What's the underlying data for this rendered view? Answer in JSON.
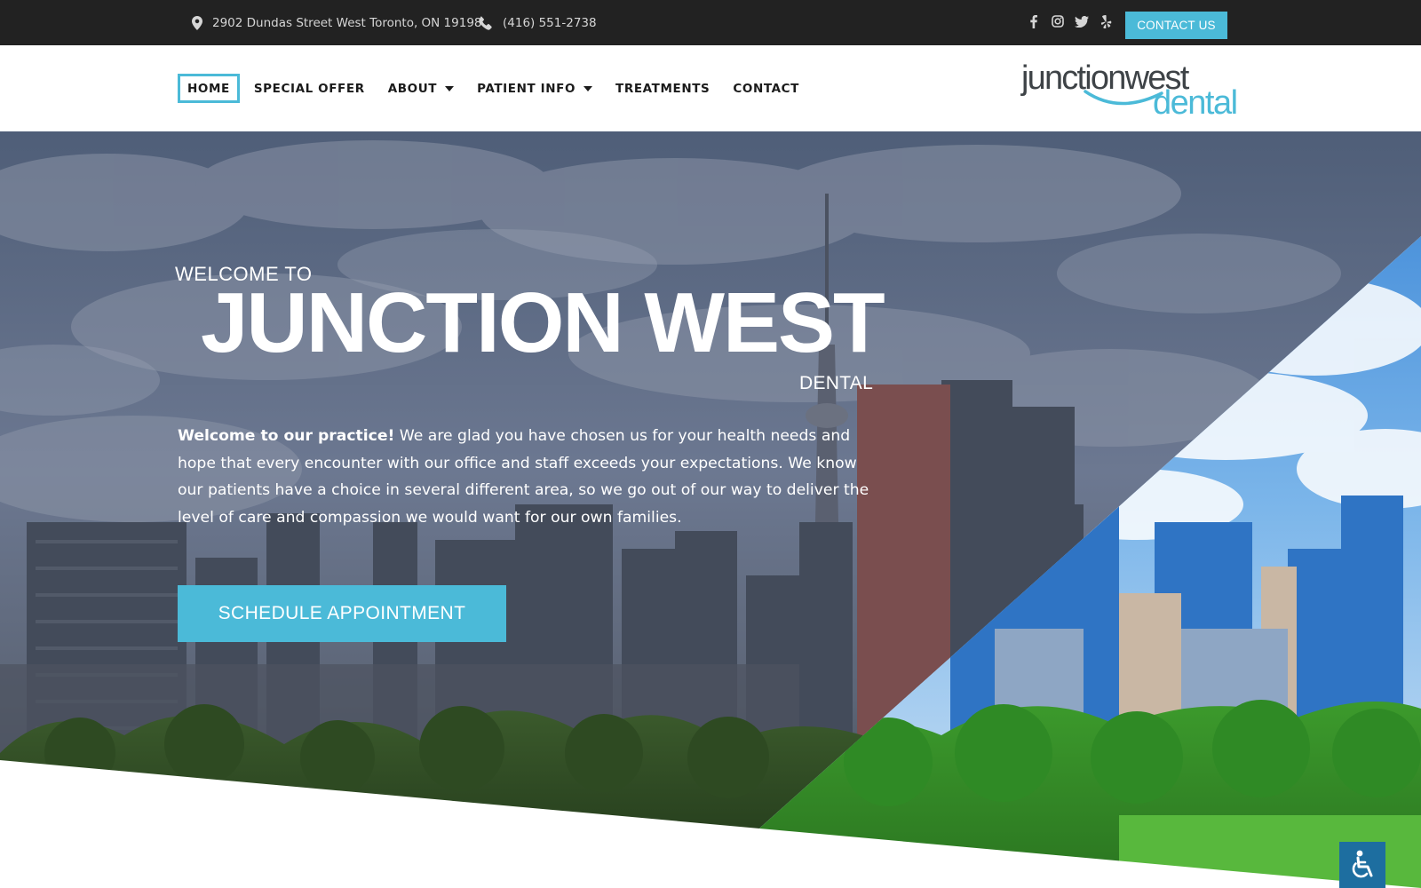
{
  "topbar": {
    "address": "2902 Dundas Street West Toronto, ON 19198",
    "phone": "(416) 551-2738",
    "socials": [
      "facebook-icon",
      "instagram-icon",
      "twitter-icon",
      "yelp-icon"
    ],
    "contact_label": "CONTACT US"
  },
  "nav": {
    "items": [
      {
        "label": "HOME",
        "active": true
      },
      {
        "label": "SPECIAL OFFER"
      },
      {
        "label": "ABOUT",
        "dropdown": true
      },
      {
        "label": "PATIENT INFO",
        "dropdown": true
      },
      {
        "label": "TREATMENTS"
      },
      {
        "label": "CONTACT"
      }
    ]
  },
  "logo": {
    "line1": "junctionwest",
    "line2": "dental"
  },
  "hero": {
    "welcome": "WELCOME TO",
    "title": "JUNCTION WEST",
    "subtitle": "DENTAL",
    "body_strong": "Welcome to our practice!",
    "body_text": " We are glad you have chosen us for your health needs and hope that every encounter with our office and staff exceeds your expectations. We know our patients have a choice in several different area, so we go out of our way to deliver the level of care and compassion we would want for our own families.",
    "cta_label": "SCHEDULE APPOINTMENT"
  },
  "accessibility": {
    "icon": "wheelchair-icon"
  },
  "colors": {
    "accent": "#4bbad8",
    "topbar_bg": "#222222",
    "nav_text": "#1b1b1b",
    "logo_grey": "#3e4347",
    "a11y_bg": "#1d6ea0"
  }
}
